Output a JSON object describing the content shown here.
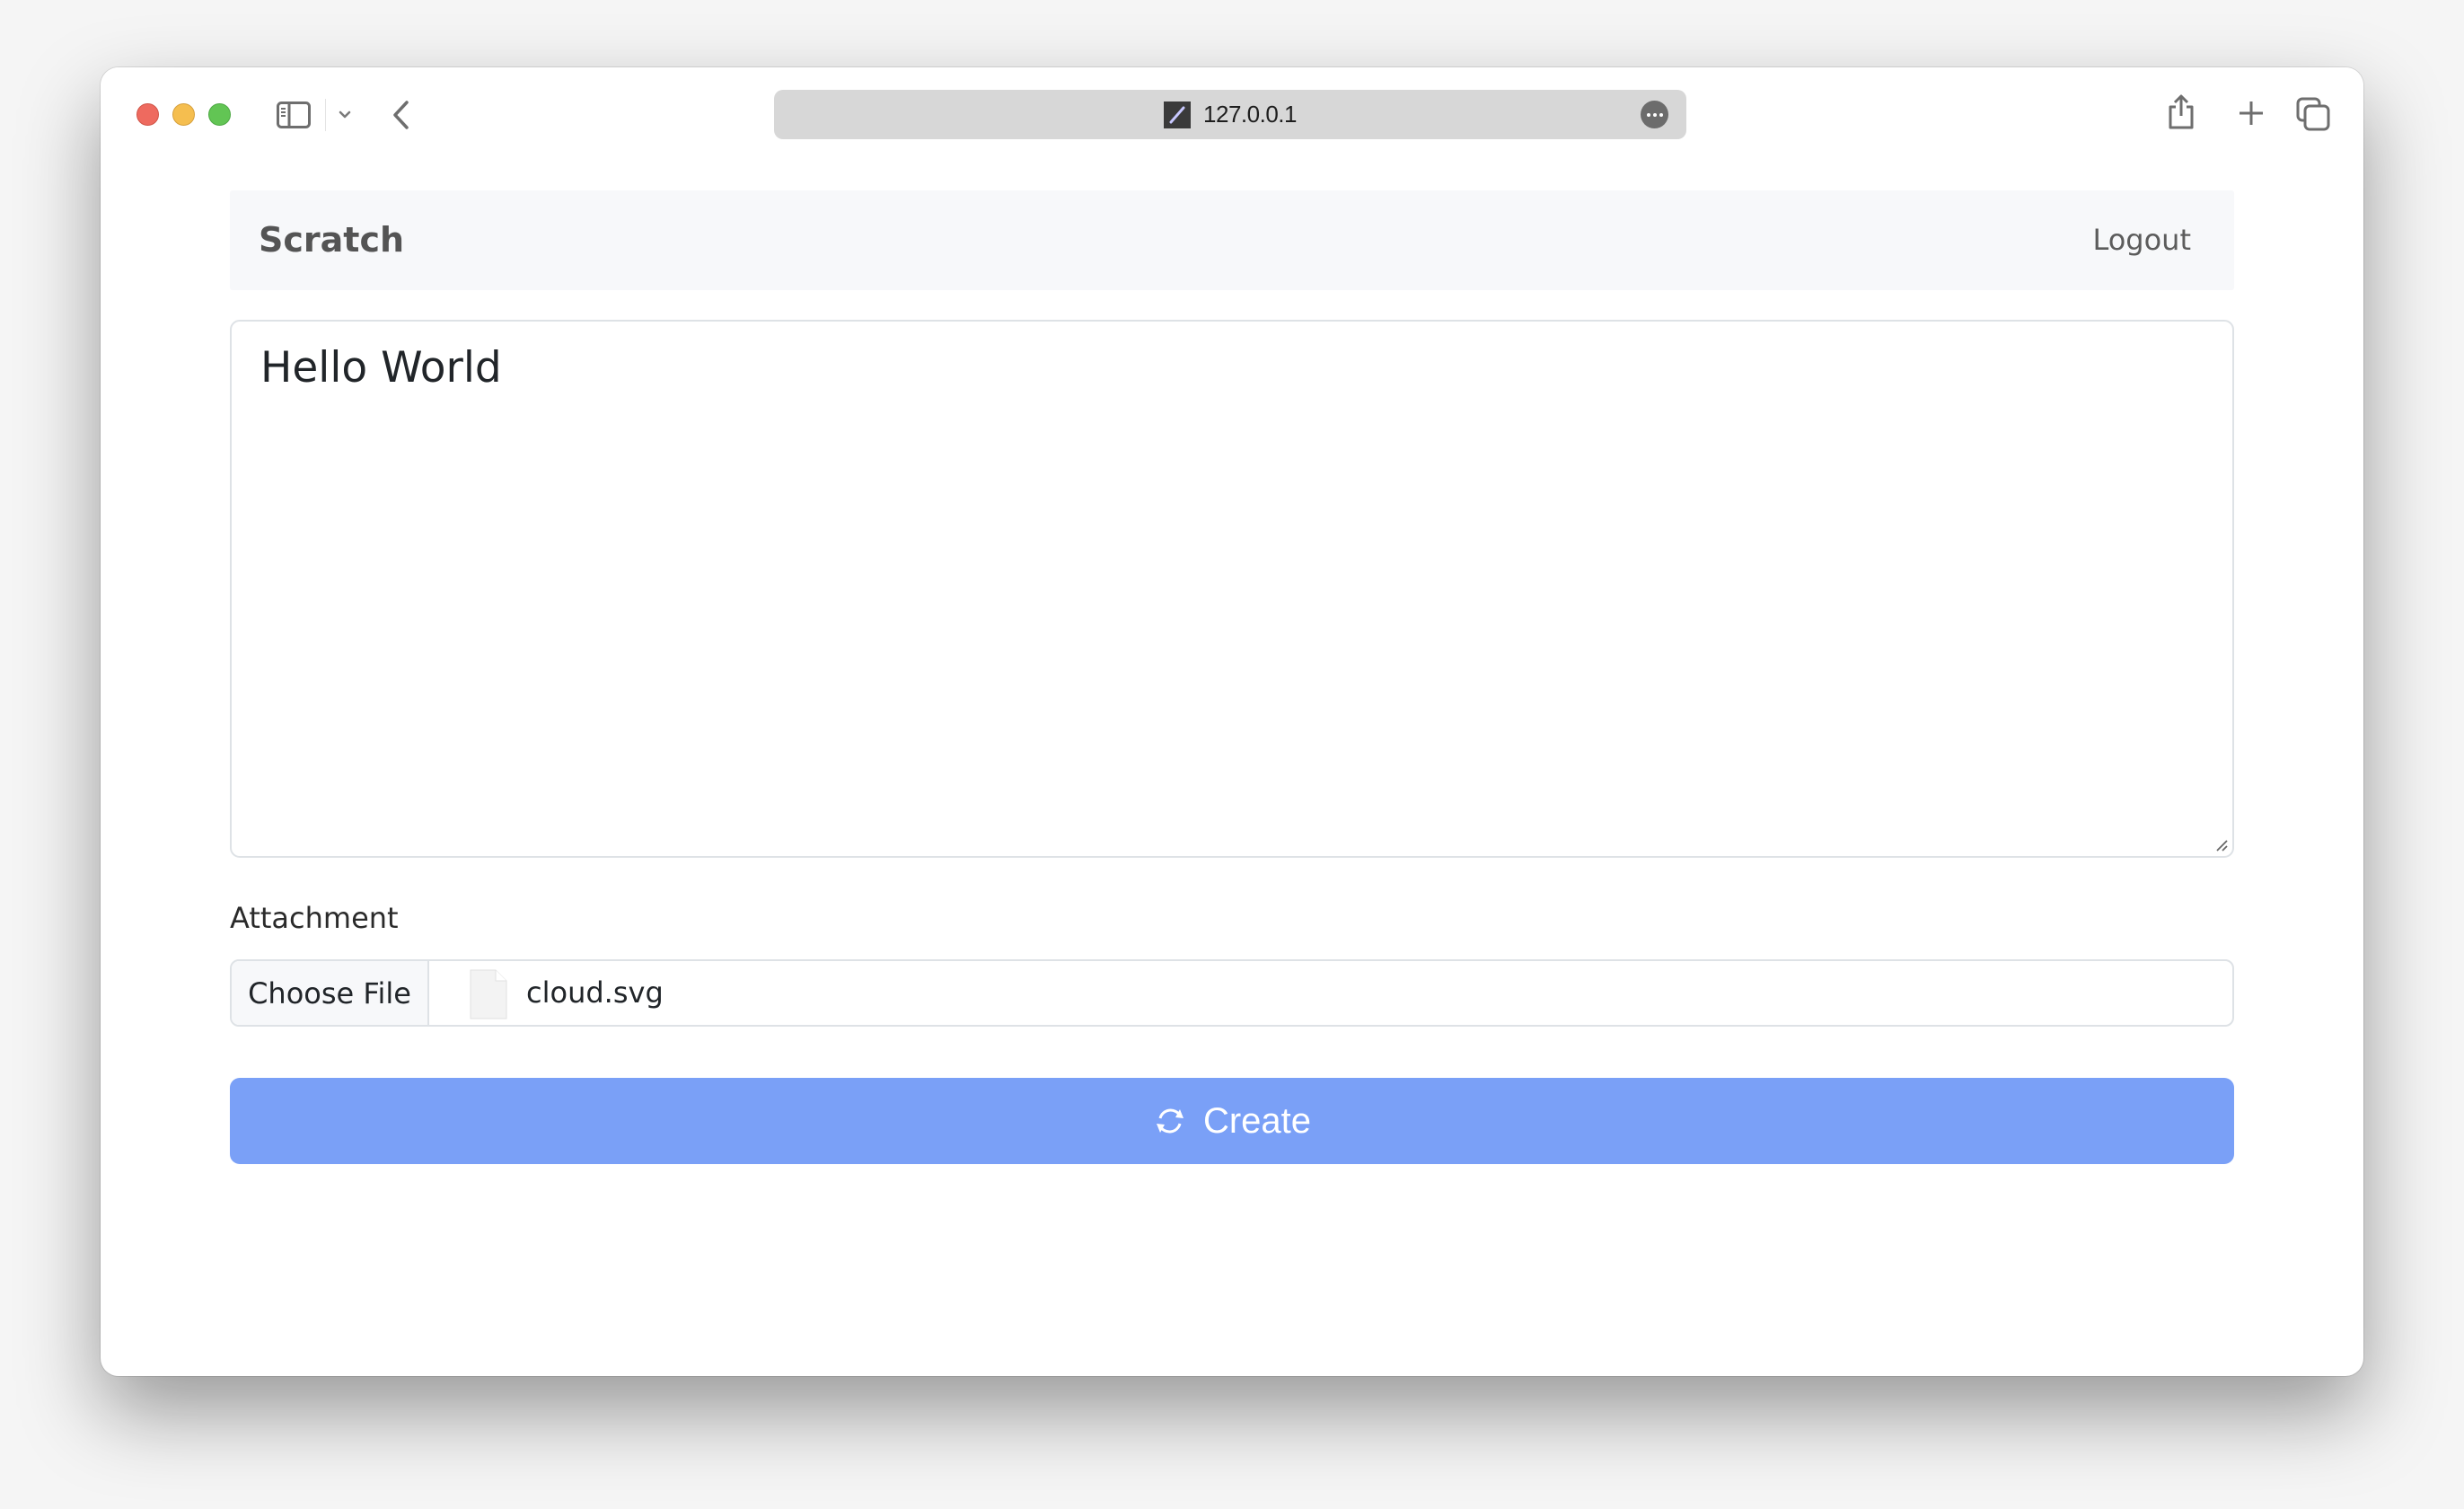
{
  "browser": {
    "url": "127.0.0.1",
    "icons": {
      "sidebar_toggle": "sidebar-icon",
      "chevron": "chevron-down-icon",
      "back": "chevron-left-icon",
      "favicon": "pencil-icon",
      "more": "ellipsis-icon",
      "share": "share-icon",
      "new_tab": "plus-icon",
      "tabs_overview": "tabs-icon"
    }
  },
  "navbar": {
    "brand": "Scratch",
    "logout_label": "Logout"
  },
  "note": {
    "content": "Hello World"
  },
  "attachment": {
    "label": "Attachment",
    "choose_button_label": "Choose File",
    "selected_file": "cloud.svg",
    "file_icon": "file-icon"
  },
  "create_button": {
    "label": "Create",
    "icon": "sync-icon",
    "color": "#7aa0f7"
  },
  "colors": {
    "navbar_bg": "#f7f8fa",
    "border": "#dee2e6",
    "text": "#212529"
  }
}
